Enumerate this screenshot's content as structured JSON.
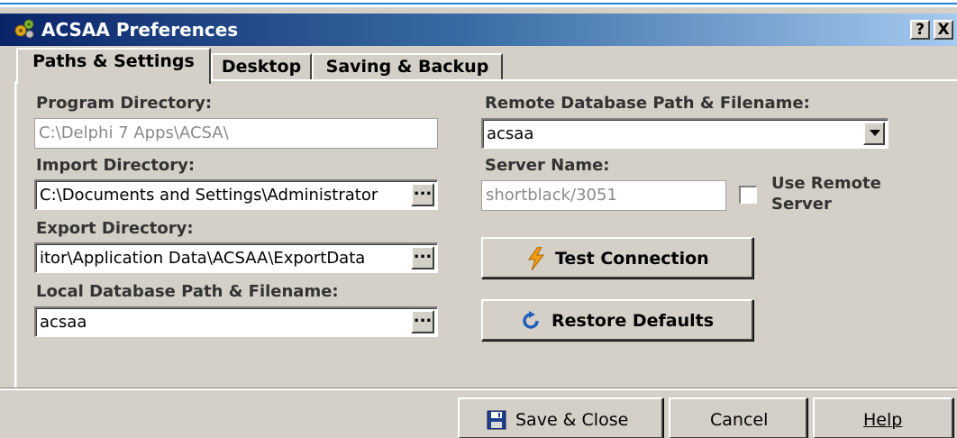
{
  "window": {
    "title": "ACSAA Preferences",
    "help_button": "?",
    "close_button": "X"
  },
  "tabs": [
    {
      "label": "Paths & Settings",
      "active": true
    },
    {
      "label": "Desktop",
      "active": false
    },
    {
      "label": "Saving & Backup",
      "active": false
    }
  ],
  "paths": {
    "program_directory": {
      "label": "Program Directory:",
      "value": "C:\\Delphi 7 Apps\\ACSA\\",
      "enabled": false
    },
    "import_directory": {
      "label": "Import Directory:",
      "value": "C:\\Documents and Settings\\Administrator",
      "browse": "..."
    },
    "export_directory": {
      "label": "Export Directory:",
      "value": "itor\\Application Data\\ACSAA\\ExportData",
      "browse": "..."
    },
    "local_database": {
      "label": "Local Database Path & Filename:",
      "value": "acsaa",
      "browse": "..."
    }
  },
  "remote": {
    "database_label": "Remote Database Path & Filename:",
    "database_value": "acsaa",
    "server_label": "Server Name:",
    "server_value": "shortblack/3051",
    "use_remote_label_line1": "Use Remote",
    "use_remote_label_line2": "Server",
    "use_remote_checked": false
  },
  "actions": {
    "test_connection": "Test Connection",
    "restore_defaults": "Restore Defaults"
  },
  "footer": {
    "save_close": "Save & Close",
    "cancel": "Cancel",
    "help": "Help"
  },
  "icons": {
    "app": "gear-cluster-icon",
    "test_connection": "lightning-bolt-icon",
    "restore_defaults": "refresh-arrow-icon",
    "save_close": "floppy-disk-icon"
  },
  "colors": {
    "title_gradient_start": "#0a246a",
    "title_gradient_end": "#a6caf0",
    "face": "#d4d0c8",
    "bolt": "#f0a010",
    "restore_arrow": "#1f5fb8"
  }
}
